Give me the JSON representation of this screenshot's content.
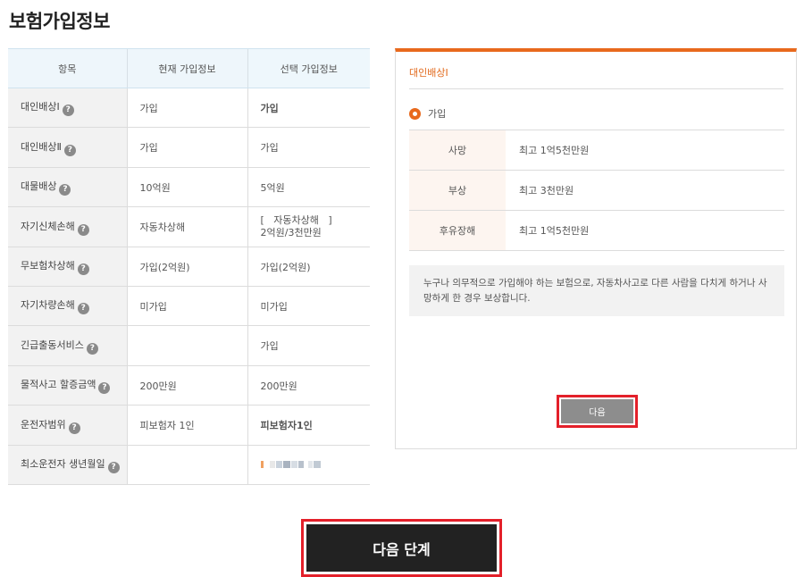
{
  "page_title": "보험가입정보",
  "table": {
    "headers": [
      "항목",
      "현재 가입정보",
      "선택 가입정보"
    ],
    "rows": [
      {
        "label": "대인배상Ⅰ",
        "current": "가입",
        "selected": "가입",
        "selected_style": "orange"
      },
      {
        "label": "대인배상Ⅱ",
        "current": "가입",
        "selected": "가입"
      },
      {
        "label": "대물배상",
        "current": "10억원",
        "selected": "5억원"
      },
      {
        "label": "자기신체손해",
        "current": "자동차상해",
        "selected": "[   자동차상해   ]",
        "selected_line2": "2억원/3천만원"
      },
      {
        "label": "무보험차상해",
        "current": "가입(2억원)",
        "selected": "가입(2억원)"
      },
      {
        "label": "자기차량손해",
        "current": "미가입",
        "selected": "미가입"
      },
      {
        "label": "긴급출동서비스",
        "current": "",
        "selected": "가입"
      },
      {
        "label": "물적사고 할증금액",
        "current": "200만원",
        "selected": "200만원"
      },
      {
        "label": "운전자범위",
        "current": "피보험자 1인",
        "selected": "피보험자1인",
        "selected_style": "bold"
      },
      {
        "label": "최소운전자 생년월일",
        "current": "",
        "selected": ""
      }
    ],
    "help_glyph": "?"
  },
  "panel": {
    "title": "대인배상Ⅰ",
    "radio_label": "가입",
    "coverage": [
      {
        "key": "사망",
        "value": "최고 1억5천만원"
      },
      {
        "key": "부상",
        "value": "최고 3천만원"
      },
      {
        "key": "후유장해",
        "value": "최고 1억5천만원"
      }
    ],
    "description": "누구나 의무적으로 가입해야 하는 보험으로, 자동차사고로 다른 사람을 다치게 하거나 사망하게 한 경우 보상합니다.",
    "next_label": "다음"
  },
  "next_step_label": "다음 단계",
  "colors": {
    "accent": "#e8691d",
    "highlight_border": "#e3202a",
    "dark_button": "#222222"
  }
}
